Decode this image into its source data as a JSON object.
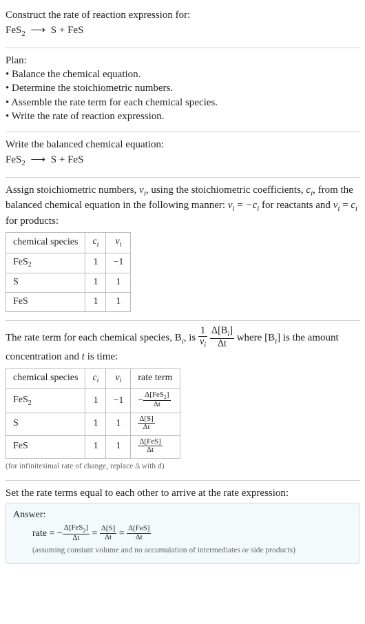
{
  "prompt": {
    "line1": "Construct the rate of reaction expression for:",
    "reactant": "FeS",
    "reactant_sub": "2",
    "arrow": "⟶",
    "prod1": "S",
    "plus": "+",
    "prod2": "FeS"
  },
  "plan": {
    "heading": "Plan:",
    "items": [
      "• Balance the chemical equation.",
      "• Determine the stoichiometric numbers.",
      "• Assemble the rate term for each chemical species.",
      "• Write the rate of reaction expression."
    ]
  },
  "balance": {
    "heading": "Write the balanced chemical equation:",
    "reactant": "FeS",
    "reactant_sub": "2",
    "arrow": "⟶",
    "prod1": "S",
    "plus": "+",
    "prod2": "FeS"
  },
  "stoich": {
    "intro_a": "Assign stoichiometric numbers, ",
    "nu_i": "ν",
    "sub_i": "i",
    "intro_b": ", using the stoichiometric coefficients, ",
    "c_i": "c",
    "intro_c": ", from the balanced chemical equation in the following manner: ",
    "rel1_lhs": "ν",
    "eq": " = ",
    "rel1_rhs_neg": "−c",
    "rel1_tail": " for reactants and ",
    "rel2_rhs": "c",
    "rel2_tail": " for products:",
    "headers": {
      "species": "chemical species",
      "ci": "c",
      "nui": "ν"
    },
    "rows": [
      {
        "species": "FeS",
        "species_sub": "2",
        "ci": "1",
        "nui": "−1"
      },
      {
        "species": "S",
        "species_sub": "",
        "ci": "1",
        "nui": "1"
      },
      {
        "species": "FeS",
        "species_sub": "",
        "ci": "1",
        "nui": "1"
      }
    ]
  },
  "rateterm": {
    "intro_a": "The rate term for each chemical species, B",
    "sub_i": "i",
    "intro_b": ", is ",
    "frac1_num": "1",
    "frac1_den_sym": "ν",
    "frac2_num_a": "Δ[B",
    "frac2_num_b": "]",
    "frac2_den": "Δt",
    "intro_c": " where [B",
    "intro_d": "] is the amount concentration and ",
    "t": "t",
    "intro_e": " is time:",
    "headers": {
      "species": "chemical species",
      "ci": "c",
      "nui": "ν",
      "rate": "rate term"
    },
    "rows": [
      {
        "species": "FeS",
        "species_sub": "2",
        "ci": "1",
        "nui": "−1",
        "neg": "−",
        "num_a": "Δ[FeS",
        "num_sub": "2",
        "num_b": "]",
        "den": "Δt"
      },
      {
        "species": "S",
        "species_sub": "",
        "ci": "1",
        "nui": "1",
        "neg": "",
        "num_a": "Δ[S",
        "num_sub": "",
        "num_b": "]",
        "den": "Δt"
      },
      {
        "species": "FeS",
        "species_sub": "",
        "ci": "1",
        "nui": "1",
        "neg": "",
        "num_a": "Δ[FeS",
        "num_sub": "",
        "num_b": "]",
        "den": "Δt"
      }
    ],
    "footnote": "(for infinitesimal rate of change, replace Δ with d)"
  },
  "final": {
    "heading": "Set the rate terms equal to each other to arrive at the rate expression:",
    "answer_label": "Answer:",
    "rate_word": "rate",
    "eq": " = ",
    "neg": "−",
    "t1_num_a": "Δ[FeS",
    "t1_num_sub": "2",
    "t1_num_b": "]",
    "t1_den": "Δt",
    "t2_num": "Δ[S]",
    "t2_den": "Δt",
    "t3_num": "Δ[FeS]",
    "t3_den": "Δt",
    "assumption": "(assuming constant volume and no accumulation of intermediates or side products)"
  }
}
